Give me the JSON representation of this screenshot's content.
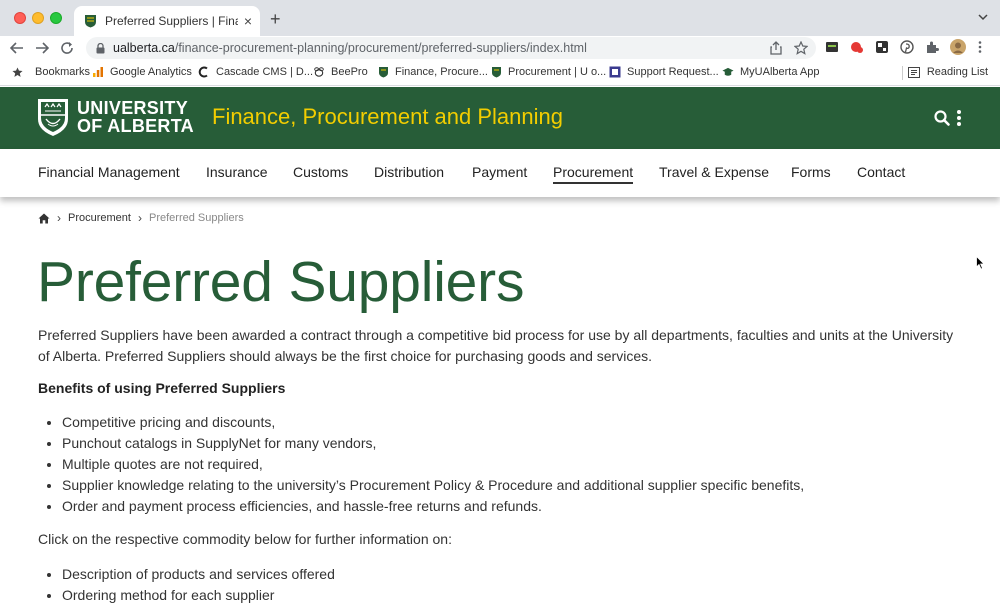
{
  "browser": {
    "tab_title": "Preferred Suppliers | Finance, P",
    "tab_close": "×",
    "new_tab": "+",
    "url_domain": "ualberta.ca",
    "url_path": "/finance-procurement-planning/procurement/preferred-suppliers/index.html",
    "bookmarks": [
      {
        "label": "Bookmarks",
        "icon": "star-icon"
      },
      {
        "label": "Google Analytics",
        "icon": "analytics-icon"
      },
      {
        "label": "Cascade CMS | D...",
        "icon": "cascade-icon"
      },
      {
        "label": "BeePro",
        "icon": "bee-icon"
      },
      {
        "label": "Finance, Procure...",
        "icon": "ualberta-crest-icon"
      },
      {
        "label": "Procurement | U o...",
        "icon": "ualberta-crest-icon"
      },
      {
        "label": "Support Request...",
        "icon": "support-icon"
      },
      {
        "label": "MyUAlberta App",
        "icon": "graduation-cap-icon"
      }
    ],
    "reading_list": "Reading List"
  },
  "site": {
    "logo_line1": "UNIVERSITY",
    "logo_line2": "OF ALBERTA",
    "title": "Finance, Procurement and Planning",
    "brand_green": "#275d38",
    "brand_gold": "#f2cd00"
  },
  "nav": {
    "items": [
      "Financial Management",
      "Insurance",
      "Customs",
      "Distribution",
      "Payment",
      "Procurement",
      "Travel & Expense",
      "Forms",
      "Contact"
    ],
    "active": "Procurement"
  },
  "breadcrumb": {
    "home_icon": "home-icon",
    "items": [
      "Procurement",
      "Preferred Suppliers"
    ]
  },
  "content": {
    "title": "Preferred Suppliers",
    "intro": "Preferred Suppliers have been awarded a contract through a competitive bid process for use by all departments, faculties and units at the University of Alberta. Preferred Suppliers should always be the first choice for purchasing goods and services.",
    "benefits_heading": "Benefits of using Preferred Suppliers",
    "benefits": [
      "Competitive pricing and discounts,",
      "Punchout catalogs in SupplyNet for many vendors,",
      "Multiple quotes are not required,",
      "Supplier knowledge relating to the university’s Procurement Policy & Procedure and additional supplier specific benefits,",
      "Order and payment process efficiencies, and hassle-free returns and refunds."
    ],
    "click_text": "Click on the respective commodity below for further information on:",
    "info_items": [
      "Description of products and services offered",
      "Ordering method for each supplier"
    ]
  }
}
